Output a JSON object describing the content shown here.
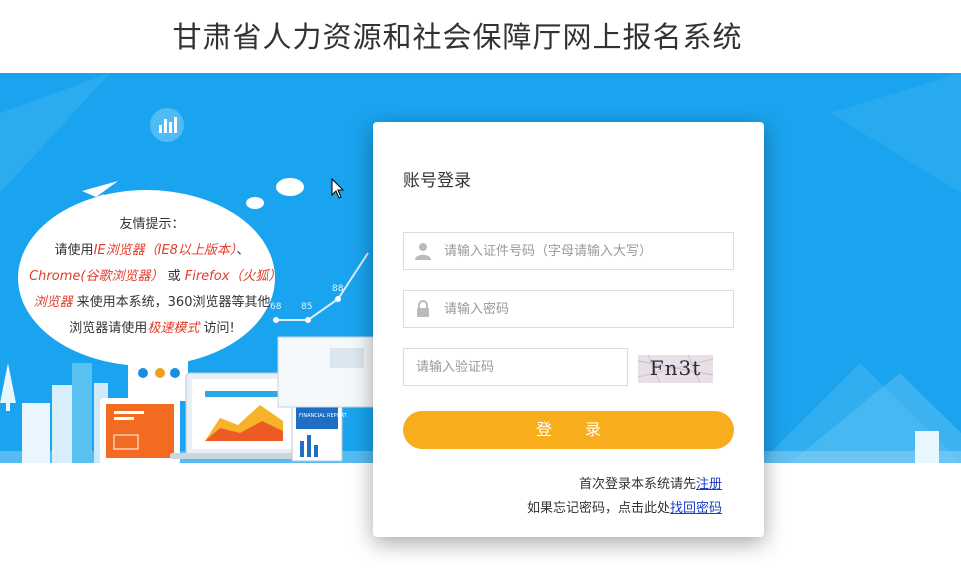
{
  "header": {
    "title": "甘肃省人力资源和社会保障厅网上报名系统"
  },
  "tip": {
    "title": "友情提示：",
    "line2_prefix": "请使用",
    "ie": "IE浏览器（IE8以上版本）",
    "line2_suffix": "、",
    "chrome": "Chrome(谷歌浏览器）",
    "or": " 或 ",
    "firefox": "Firefox（火狐）浏览器",
    "line4_suffix": " 来使用本系统，360浏览器等其他浏览器请使用",
    "fast_mode": "极速模式",
    "visit": " 访问!"
  },
  "illustration": {
    "chart_labels": [
      "68",
      "85",
      "88"
    ],
    "report_label": "FINANCIAL REPORT"
  },
  "login": {
    "title": "账号登录",
    "id_placeholder": "请输入证件号码（字母请输入大写）",
    "password_placeholder": "请输入密码",
    "captcha_placeholder": "请输入验证码",
    "captcha_text": "Fn3t",
    "submit_label": "登 录",
    "register_hint": "首次登录本系统请先",
    "register_link": "注册",
    "forgot_hint": "如果忘记密码，点击此处",
    "forgot_link": "找回密码"
  },
  "colors": {
    "banner": "#1aa3ee",
    "button": "#f8ad1c",
    "link": "#1b3ec2",
    "accent_red": "#e33b2b"
  },
  "icons": [
    "user-icon",
    "lock-icon",
    "stats-icon",
    "paper-plane-icon",
    "mouse-cursor-icon"
  ]
}
